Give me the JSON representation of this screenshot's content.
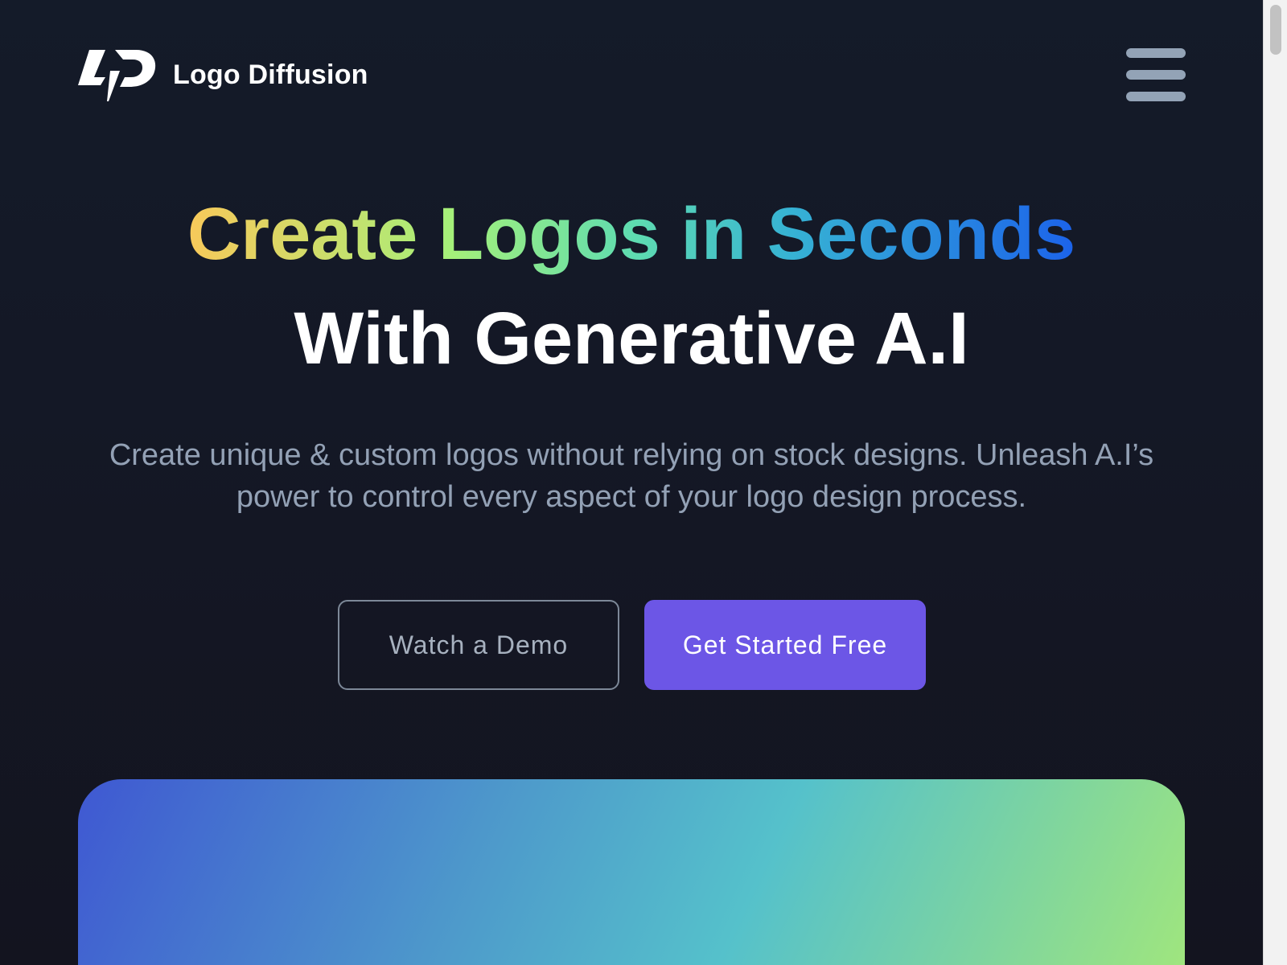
{
  "brand": {
    "name": "Logo Diffusion",
    "logo_icon": "logo-diffusion-mark"
  },
  "nav": {
    "menu_icon": "hamburger-menu-icon"
  },
  "hero": {
    "headline_line1": {
      "word1": "Create",
      "word2": "Logos",
      "word3": "in",
      "word4": "Seconds"
    },
    "headline_line2": "With Generative A.I",
    "subtitle": "Create unique & custom logos without relying on stock designs. Unleash A.I’s power to control every aspect of your logo design process."
  },
  "actions": {
    "demo_label": "Watch a Demo",
    "start_label": "Get Started Free"
  },
  "colors": {
    "background": "#141826",
    "accent": "#6c56e6",
    "subtitle_text": "#93a1b5",
    "headline_gradient": [
      "#f8c95a",
      "#a4f07a",
      "#5fdcb0",
      "#36b2d4",
      "#1c63ea"
    ],
    "preview_gradient": [
      "#3f58d2",
      "#55c1cb",
      "#a2e77b"
    ]
  }
}
